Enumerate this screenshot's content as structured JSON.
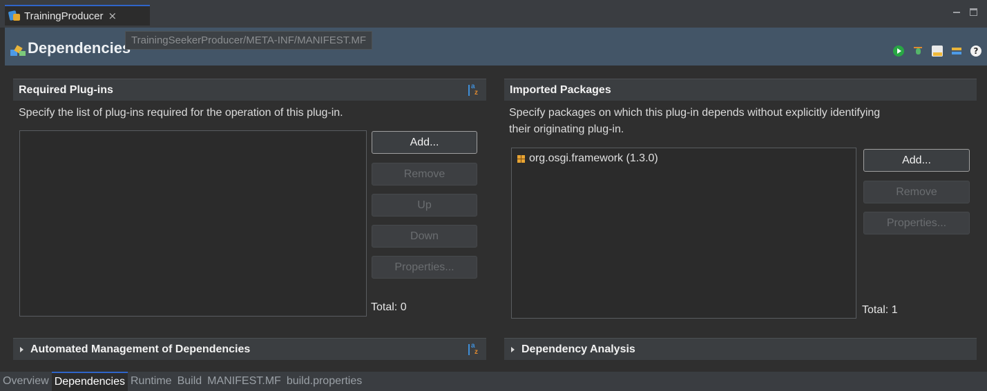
{
  "editor_tab": {
    "title": "TrainingProducer",
    "close": "×"
  },
  "tooltip": "TrainingSeekerProducer/META-INF/MANIFEST.MF",
  "form": {
    "title": "Dependencies"
  },
  "toolbar_icons": [
    "run-icon",
    "debug-icon",
    "export-icon",
    "deps-icon",
    "help-icon"
  ],
  "toolbar_help_glyph": "?",
  "required_plugins": {
    "title": "Required Plug-ins",
    "description": "Specify the list of plug-ins required for the operation of this plug-in.",
    "items": [],
    "buttons": {
      "add": "Add...",
      "remove": "Remove",
      "up": "Up",
      "down": "Down",
      "properties": "Properties..."
    },
    "total": "Total: 0"
  },
  "imported_packages": {
    "title": "Imported Packages",
    "description_line1": "Specify packages on which this plug-in depends without explicitly identifying",
    "description_line2": "their originating plug-in.",
    "items": [
      {
        "label": "org.osgi.framework (1.3.0)"
      }
    ],
    "buttons": {
      "add": "Add...",
      "remove": "Remove",
      "properties": "Properties..."
    },
    "total": "Total: 1"
  },
  "automated_management": {
    "title": "Automated Management of Dependencies"
  },
  "dependency_analysis": {
    "title": "Dependency Analysis"
  },
  "page_tabs": {
    "overview": "Overview",
    "dependencies": "Dependencies",
    "runtime": "Runtime",
    "build": "Build",
    "manifest": "MANIFEST.MF",
    "build_properties": "build.properties",
    "active": "Dependencies"
  },
  "colors": {
    "accent": "#2f65ca",
    "header_bg": "#435567",
    "background": "#2f2f2f"
  }
}
